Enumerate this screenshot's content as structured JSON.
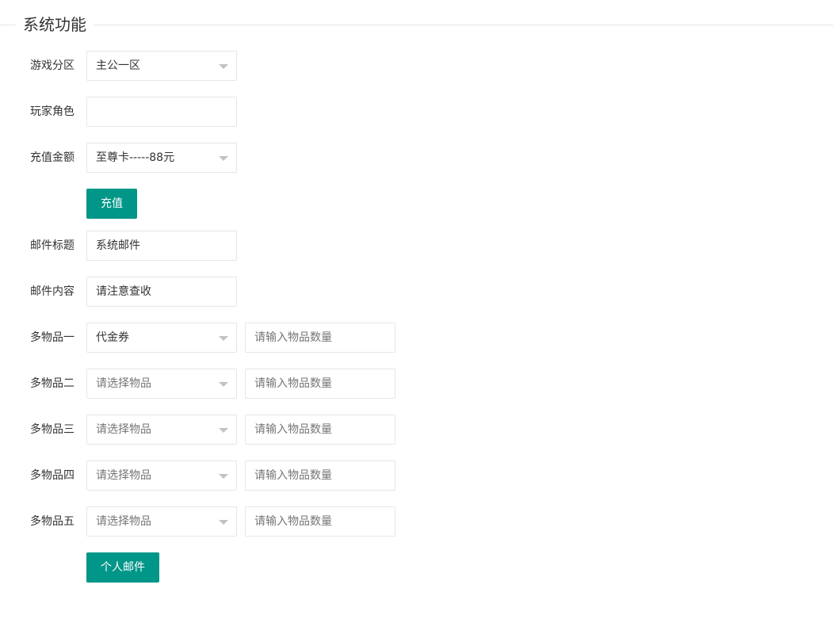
{
  "section": {
    "title": "系统功能"
  },
  "recharge": {
    "server_label": "游戏分区",
    "server_value": "主公一区",
    "role_label": "玩家角色",
    "role_value": "",
    "amount_label": "充值金额",
    "amount_value": "至尊卡-----88元",
    "submit_label": "充值"
  },
  "mail": {
    "title_label": "邮件标题",
    "title_value": "系统邮件",
    "content_label": "邮件内容",
    "content_value": "请注意查收",
    "items": [
      {
        "label": "多物品一",
        "item_value": "代金券",
        "item_placeholder": "请选择物品",
        "qty_placeholder": "请输入物品数量"
      },
      {
        "label": "多物品二",
        "item_value": "",
        "item_placeholder": "请选择物品",
        "qty_placeholder": "请输入物品数量"
      },
      {
        "label": "多物品三",
        "item_value": "",
        "item_placeholder": "请选择物品",
        "qty_placeholder": "请输入物品数量"
      },
      {
        "label": "多物品四",
        "item_value": "",
        "item_placeholder": "请选择物品",
        "qty_placeholder": "请输入物品数量"
      },
      {
        "label": "多物品五",
        "item_value": "",
        "item_placeholder": "请选择物品",
        "qty_placeholder": "请输入物品数量"
      }
    ],
    "submit_label": "个人邮件"
  },
  "colors": {
    "accent": "#009688",
    "border": "#e6e6e6",
    "placeholder": "#757575"
  }
}
